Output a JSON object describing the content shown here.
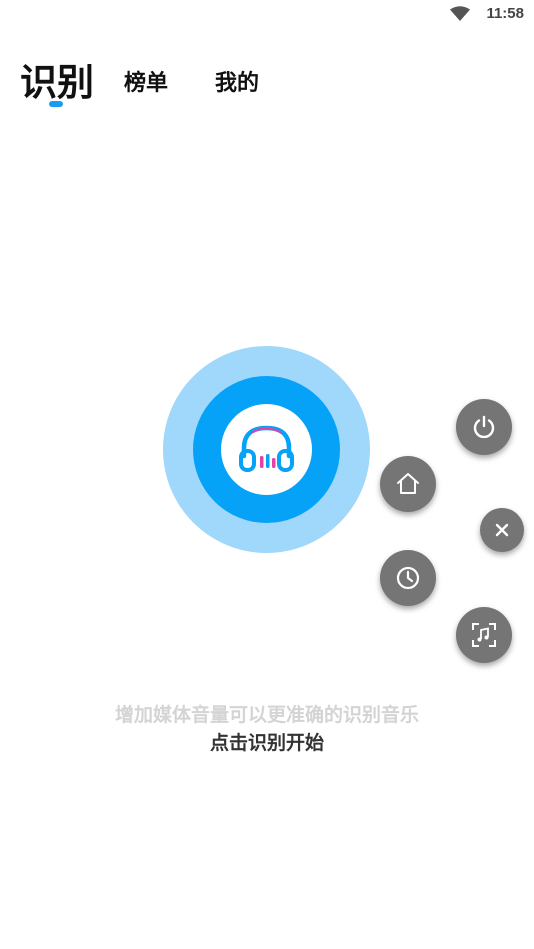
{
  "status_bar": {
    "time": "11:58",
    "icons": [
      "wifi-icon"
    ]
  },
  "tabs": [
    {
      "label": "识别",
      "active": true
    },
    {
      "label": "榜单",
      "active": false
    },
    {
      "label": "我的",
      "active": false
    }
  ],
  "colors": {
    "accent": "#06a2f8",
    "accent_light": "#9fd8fb",
    "fab_bg": "#757575",
    "headphone_pink": "#e83fa5"
  },
  "recognize_button": {
    "icon": "headphones-icon"
  },
  "floating_menu": {
    "buttons": [
      {
        "icon": "power-icon"
      },
      {
        "icon": "home-icon"
      },
      {
        "icon": "close-icon"
      },
      {
        "icon": "clock-icon"
      },
      {
        "icon": "music-scan-icon"
      }
    ]
  },
  "hints": {
    "volume_tip": "增加媒体音量可以更准确的识别音乐",
    "start_tip": "点击识别开始"
  }
}
